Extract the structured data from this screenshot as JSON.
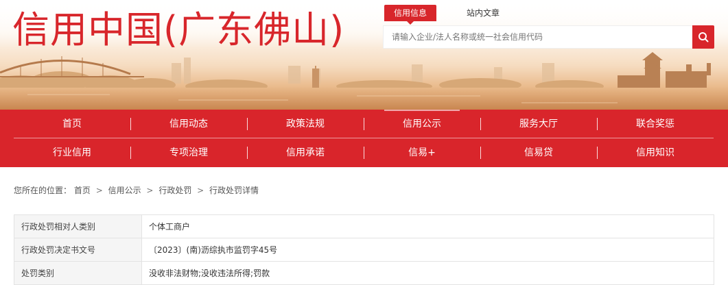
{
  "header": {
    "site_title": "信用中国(广东佛山)",
    "search_tabs": [
      {
        "label": "信用信息",
        "active": true
      },
      {
        "label": "站内文章",
        "active": false
      }
    ],
    "search_placeholder": "请输入企业/法人名称或统一社会信用代码",
    "search_icon": "search-icon"
  },
  "nav": {
    "row1": [
      {
        "label": "首页"
      },
      {
        "label": "信用动态"
      },
      {
        "label": "政策法规"
      },
      {
        "label": "信用公示",
        "active": true
      },
      {
        "label": "服务大厅"
      },
      {
        "label": "联合奖惩"
      }
    ],
    "row2": [
      {
        "label": "行业信用"
      },
      {
        "label": "专项治理"
      },
      {
        "label": "信用承诺"
      },
      {
        "label": "信易+"
      },
      {
        "label": "信易贷"
      },
      {
        "label": "信用知识"
      }
    ]
  },
  "breadcrumb": {
    "prefix": "您所在的位置：",
    "items": [
      "首页",
      "信用公示",
      "行政处罚",
      "行政处罚详情"
    ],
    "separator": ">"
  },
  "details": [
    {
      "key": "行政处罚相对人类别",
      "value": "个体工商户"
    },
    {
      "key": "行政处罚决定书文号",
      "value": "〔2023〕(南)沥综执市监罚字45号"
    },
    {
      "key": "处罚类别",
      "value": "没收非法财物;没收违法所得;罚款"
    }
  ],
  "colors": {
    "brand_red": "#d8262b",
    "nav_red": "#d9252b"
  }
}
